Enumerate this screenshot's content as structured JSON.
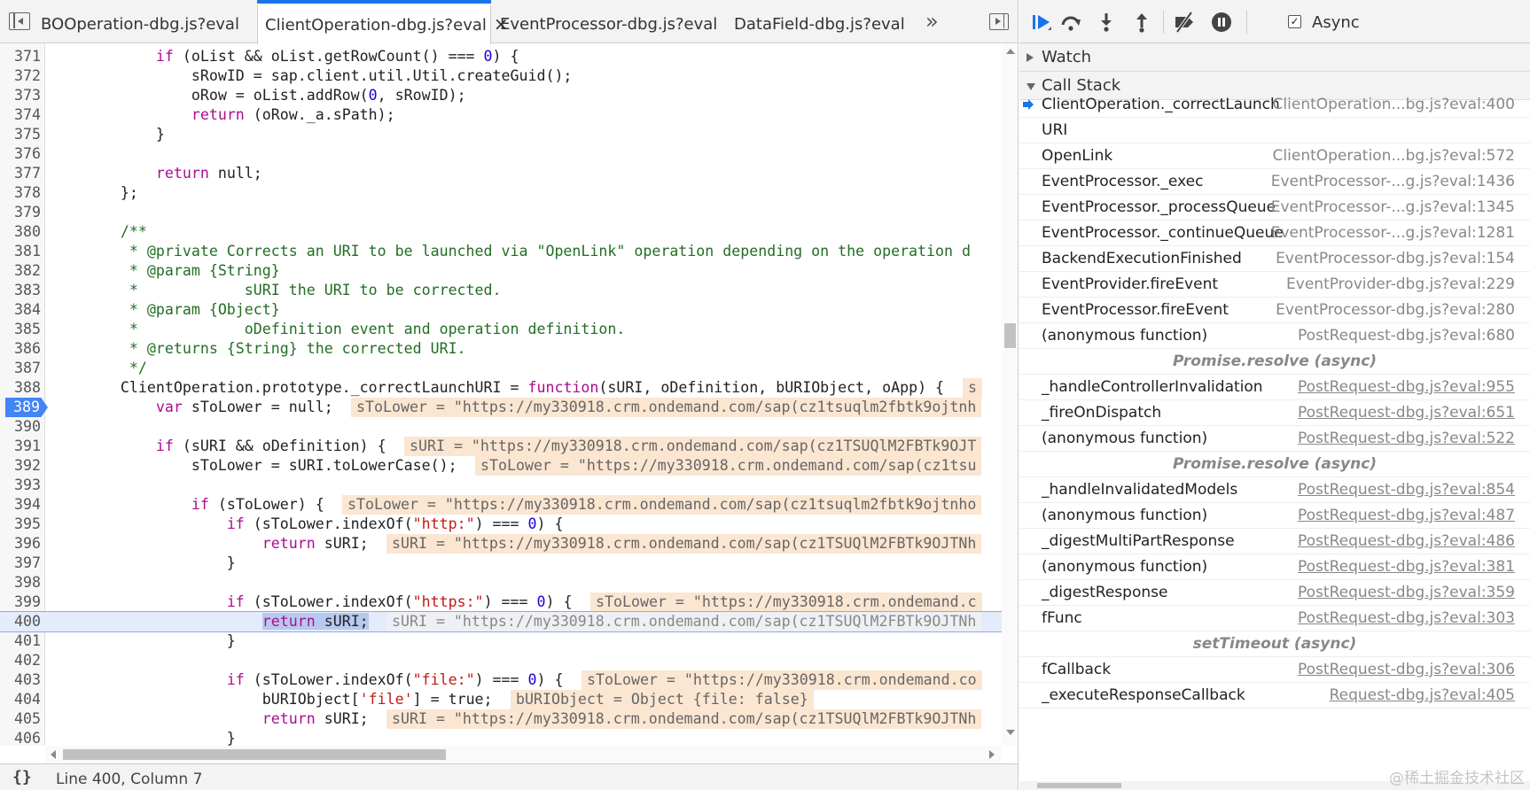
{
  "editor": {
    "tabs": [
      {
        "label": "BOOperation-dbg.js?eval",
        "active": false
      },
      {
        "label": "ClientOperation-dbg.js?eval",
        "active": true
      },
      {
        "label": "EventProcessor-dbg.js?eval",
        "active": false
      },
      {
        "label": "DataField-dbg.js?eval",
        "active": false
      }
    ],
    "tab_close_glyph": "×",
    "more_tabs_glyph": "»",
    "lines": [
      {
        "n": "371",
        "code": "            if (oList && oList.getRowCount() === 0) {",
        "hint": ""
      },
      {
        "n": "372",
        "code": "                sRowID = sap.client.util.Util.createGuid();",
        "hint": ""
      },
      {
        "n": "373",
        "code": "                oRow = oList.addRow(0, sRowID);",
        "hint": ""
      },
      {
        "n": "374",
        "code": "                return (oRow._a.sPath);",
        "hint": ""
      },
      {
        "n": "375",
        "code": "            }",
        "hint": ""
      },
      {
        "n": "376",
        "code": "",
        "hint": ""
      },
      {
        "n": "377",
        "code": "            return null;",
        "hint": ""
      },
      {
        "n": "378",
        "code": "        };",
        "hint": ""
      },
      {
        "n": "379",
        "code": "",
        "hint": ""
      },
      {
        "n": "380",
        "code": "        /**",
        "hint": "",
        "comment": true
      },
      {
        "n": "381",
        "code": "         * @private Corrects an URI to be launched via \"OpenLink\" operation depending on the operation d",
        "hint": "",
        "comment": true
      },
      {
        "n": "382",
        "code": "         * @param {String}",
        "hint": "",
        "comment": true
      },
      {
        "n": "383",
        "code": "         *            sURI the URI to be corrected.",
        "hint": "",
        "comment": true
      },
      {
        "n": "384",
        "code": "         * @param {Object}",
        "hint": "",
        "comment": true
      },
      {
        "n": "385",
        "code": "         *            oDefinition event and operation definition.",
        "hint": "",
        "comment": true
      },
      {
        "n": "386",
        "code": "         * @returns {String} the corrected URI.",
        "hint": "",
        "comment": true
      },
      {
        "n": "387",
        "code": "         */",
        "hint": "",
        "comment": true
      },
      {
        "n": "388",
        "code": "        ClientOperation.prototype._correctLaunchURI = function(sURI, oDefinition, bURIObject, oApp) {",
        "hint": "s"
      },
      {
        "n": "389",
        "code": "            var sToLower = null;",
        "hint": "sToLower = \"https://my330918.crm.ondemand.com/sap(cz1tsuqlm2fbtk9ojtnh",
        "breakpoint": true
      },
      {
        "n": "390",
        "code": "",
        "hint": ""
      },
      {
        "n": "391",
        "code": "            if (sURI && oDefinition) {",
        "hint": "sURI = \"https://my330918.crm.ondemand.com/sap(cz1TSUQlM2FBTk9OJT"
      },
      {
        "n": "392",
        "code": "                sToLower = sURI.toLowerCase();",
        "hint": "sToLower = \"https://my330918.crm.ondemand.com/sap(cz1tsu"
      },
      {
        "n": "393",
        "code": "",
        "hint": ""
      },
      {
        "n": "394",
        "code": "                if (sToLower) {",
        "hint": "sToLower = \"https://my330918.crm.ondemand.com/sap(cz1tsuqlm2fbtk9ojtnho"
      },
      {
        "n": "395",
        "code": "                    if (sToLower.indexOf(\"http:\") === 0) {",
        "hint": ""
      },
      {
        "n": "396",
        "code": "                        return sURI;",
        "hint": "sURI = \"https://my330918.crm.ondemand.com/sap(cz1TSUQlM2FBTk9OJTNh"
      },
      {
        "n": "397",
        "code": "                    }",
        "hint": ""
      },
      {
        "n": "398",
        "code": "",
        "hint": ""
      },
      {
        "n": "399",
        "code": "                    if (sToLower.indexOf(\"https:\") === 0) {",
        "hint": "sToLower = \"https://my330918.crm.ondemand.c"
      },
      {
        "n": "400",
        "code": "                        return sURI;",
        "hint": "sURI = \"https://my330918.crm.ondemand.com/sap(cz1TSUQlM2FBTk9OJTNh",
        "exec": true
      },
      {
        "n": "401",
        "code": "                    }",
        "hint": ""
      },
      {
        "n": "402",
        "code": "",
        "hint": ""
      },
      {
        "n": "403",
        "code": "                    if (sToLower.indexOf(\"file:\") === 0) {",
        "hint": "sToLower = \"https://my330918.crm.ondemand.co"
      },
      {
        "n": "404",
        "code": "                        bURIObject['file'] = true;",
        "hint": "bURIObject = Object {file: false}"
      },
      {
        "n": "405",
        "code": "                        return sURI;",
        "hint": "sURI = \"https://my330918.crm.ondemand.com/sap(cz1TSUQlM2FBTk9OJTNh"
      },
      {
        "n": "406",
        "code": "                    }",
        "hint": ""
      },
      {
        "n": "407",
        "code": "",
        "hint": ""
      }
    ],
    "status": {
      "braces": "{}",
      "position": "Line 400, Column 7"
    }
  },
  "debugger": {
    "async_label": "Async",
    "async_checked": true,
    "watch_label": "Watch",
    "callstack_label": "Call Stack",
    "frames": [
      {
        "kind": "frame",
        "fn": "ClientOperation._correctLaunch",
        "loc": "ClientOperation...bg.js?eval:400",
        "current": true,
        "link": false
      },
      {
        "kind": "frame",
        "fn": "URI",
        "loc": "",
        "link": false
      },
      {
        "kind": "frame",
        "fn": "OpenLink",
        "loc": "ClientOperation...bg.js?eval:572",
        "link": false
      },
      {
        "kind": "frame",
        "fn": "EventProcessor._exec",
        "loc": "EventProcessor-...g.js?eval:1436",
        "link": false
      },
      {
        "kind": "frame",
        "fn": "EventProcessor._processQueue",
        "loc": "EventProcessor-...g.js?eval:1345",
        "link": false
      },
      {
        "kind": "frame",
        "fn": "EventProcessor._continueQueue",
        "loc": "EventProcessor-...g.js?eval:1281",
        "link": false
      },
      {
        "kind": "frame",
        "fn": "BackendExecutionFinished",
        "loc": "EventProcessor-dbg.js?eval:154",
        "link": false
      },
      {
        "kind": "frame",
        "fn": "EventProvider.fireEvent",
        "loc": "EventProvider-dbg.js?eval:229",
        "link": false
      },
      {
        "kind": "frame",
        "fn": "EventProcessor.fireEvent",
        "loc": "EventProcessor-dbg.js?eval:280",
        "link": false
      },
      {
        "kind": "frame",
        "fn": "(anonymous function)",
        "loc": "PostRequest-dbg.js?eval:680",
        "link": false
      },
      {
        "kind": "async",
        "label": "Promise.resolve (async)"
      },
      {
        "kind": "frame",
        "fn": "_handleControllerInvalidation",
        "loc": "PostRequest-dbg.js?eval:955",
        "link": true
      },
      {
        "kind": "frame",
        "fn": "_fireOnDispatch",
        "loc": "PostRequest-dbg.js?eval:651",
        "link": true
      },
      {
        "kind": "frame",
        "fn": "(anonymous function)",
        "loc": "PostRequest-dbg.js?eval:522",
        "link": true
      },
      {
        "kind": "async",
        "label": "Promise.resolve (async)"
      },
      {
        "kind": "frame",
        "fn": "_handleInvalidatedModels",
        "loc": "PostRequest-dbg.js?eval:854",
        "link": true
      },
      {
        "kind": "frame",
        "fn": "(anonymous function)",
        "loc": "PostRequest-dbg.js?eval:487",
        "link": true
      },
      {
        "kind": "frame",
        "fn": "_digestMultiPartResponse",
        "loc": "PostRequest-dbg.js?eval:486",
        "link": true
      },
      {
        "kind": "frame",
        "fn": "(anonymous function)",
        "loc": "PostRequest-dbg.js?eval:381",
        "link": true
      },
      {
        "kind": "frame",
        "fn": "_digestResponse",
        "loc": "PostRequest-dbg.js?eval:359",
        "link": true
      },
      {
        "kind": "frame",
        "fn": "fFunc",
        "loc": "PostRequest-dbg.js?eval:303",
        "link": true
      },
      {
        "kind": "async",
        "label": "setTimeout (async)"
      },
      {
        "kind": "frame",
        "fn": "fCallback",
        "loc": "PostRequest-dbg.js?eval:306",
        "link": true
      },
      {
        "kind": "frame",
        "fn": "_executeResponseCallback",
        "loc": "Request-dbg.js?eval:405",
        "link": true
      }
    ],
    "watermark": "@稀土掘金技术社区",
    "colors": {
      "accent": "#1a73e8",
      "hint_bg": "#fbe6d2",
      "exec_line_bg": "#e4ecfb"
    }
  }
}
